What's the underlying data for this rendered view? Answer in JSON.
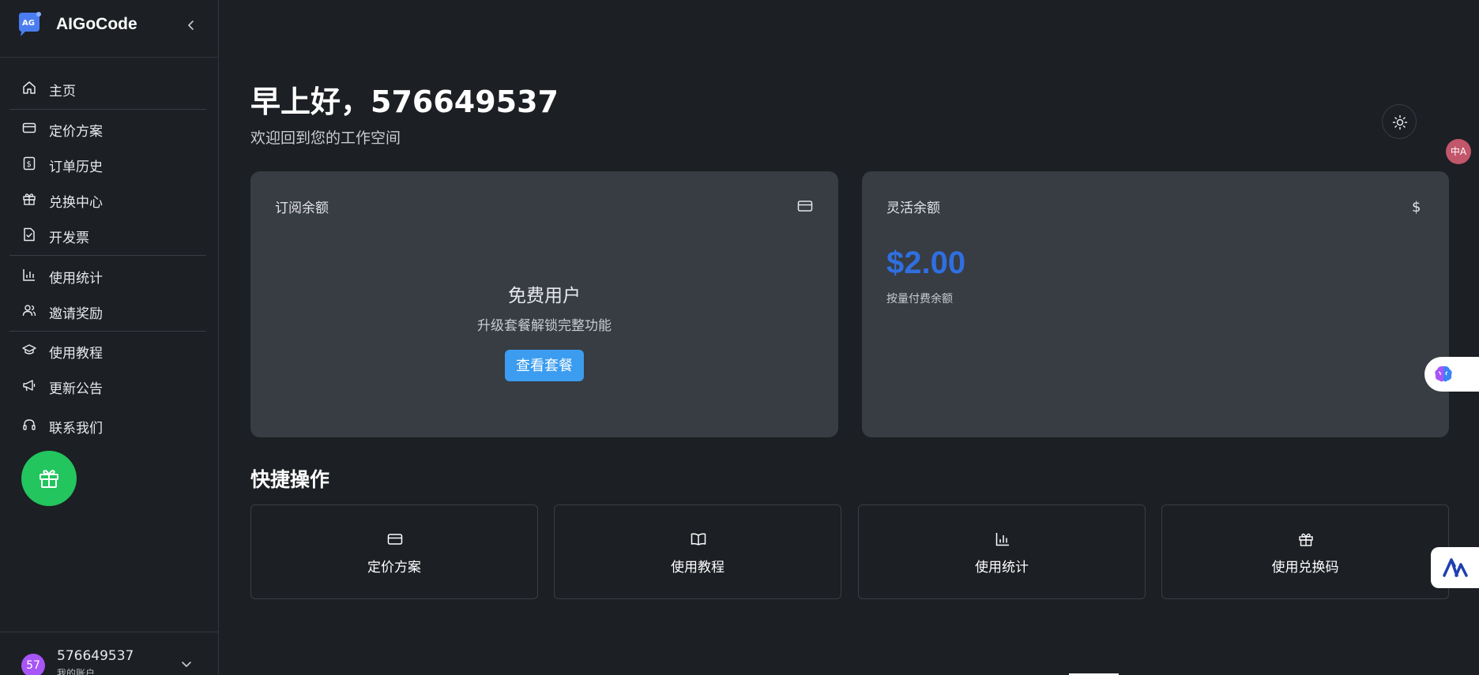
{
  "brand": {
    "name": "AIGoCode"
  },
  "sidebar": {
    "items": [
      {
        "label": "主页",
        "icon": "home-icon"
      },
      {
        "label": "定价方案",
        "icon": "credit-card-icon"
      },
      {
        "label": "订单历史",
        "icon": "receipt-dollar-icon"
      },
      {
        "label": "兑换中心",
        "icon": "gift-icon"
      },
      {
        "label": "开发票",
        "icon": "invoice-file-icon"
      },
      {
        "label": "使用统计",
        "icon": "bar-chart-icon"
      },
      {
        "label": "邀请奖励",
        "icon": "users-icon"
      },
      {
        "label": "使用教程",
        "icon": "graduation-cap-icon"
      },
      {
        "label": "更新公告",
        "icon": "megaphone-icon"
      },
      {
        "label": "联系我们",
        "icon": "headset-icon"
      }
    ]
  },
  "user": {
    "avatar_initials": "57",
    "name": "576649537",
    "subtitle": "我的账户"
  },
  "header": {
    "greeting": "早上好，576649537",
    "subtitle": "欢迎回到您的工作空间"
  },
  "translate_badge": "中A",
  "subscription_card": {
    "title": "订阅余额",
    "plan_name": "免费用户",
    "plan_hint": "升级套餐解锁完整功能",
    "button_label": "查看套餐"
  },
  "flex_card": {
    "title": "灵活余额",
    "amount": "$2.00",
    "note": "按量付费余额"
  },
  "quick_actions": {
    "title": "快捷操作",
    "items": [
      {
        "label": "定价方案",
        "icon": "credit-card-icon"
      },
      {
        "label": "使用教程",
        "icon": "book-open-icon"
      },
      {
        "label": "使用统计",
        "icon": "bar-chart-icon"
      },
      {
        "label": "使用兑换码",
        "icon": "gift-icon"
      }
    ]
  },
  "colors": {
    "background": "#1c1f23",
    "card": "#383c43",
    "accent_blue": "#3b9cf0",
    "balance_blue": "#2f6fe0",
    "gift_green": "#22c55e",
    "avatar_purple": "#a855f7"
  }
}
